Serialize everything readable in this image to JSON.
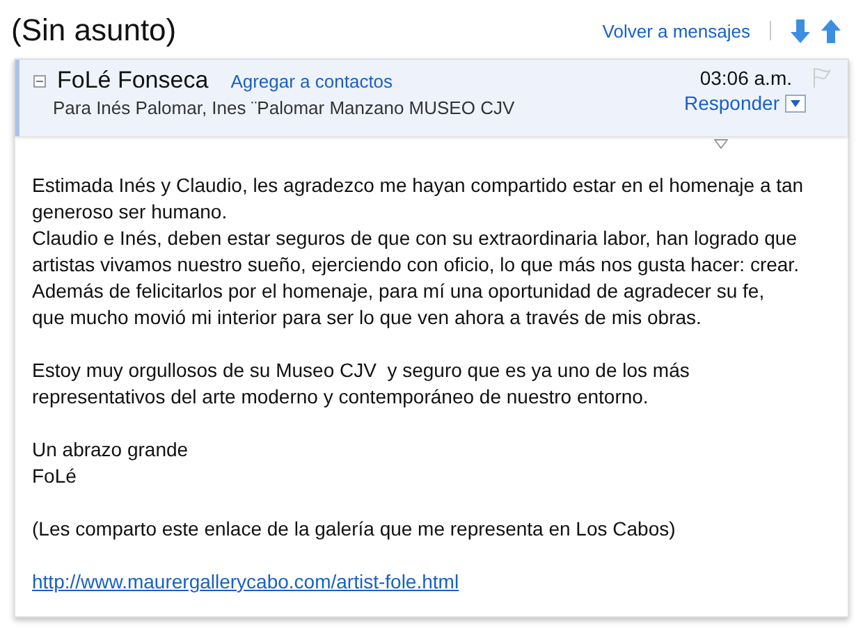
{
  "subject": "(Sin asunto)",
  "back_link": "Volver a mensajes",
  "message": {
    "sender": "FoLé Fonseca",
    "add_contact": "Agregar a contactos",
    "recipients": "Para Inés Palomar, Ines ¨Palomar Manzano MUSEO CJV",
    "time": "03:06 a.m.",
    "reply": "Responder",
    "flagged": false,
    "expanded": true
  },
  "body": [
    {
      "kind": "text",
      "text": "Estimada Inés y Claudio, les agradezco me hayan compartido estar en el homenaje a tan\ngeneroso ser humano.\nClaudio e Inés, deben estar seguros de que con su extraordinaria labor, han logrado que\nartistas vivamos nuestro sueño, ejerciendo con oficio, lo que más nos gusta hacer: crear.\nAdemás de felicitarlos por el homenaje, para mí una oportunidad de agradecer su fe,\nque mucho movió mi interior para ser lo que ven ahora a través de mis obras."
    },
    {
      "kind": "text",
      "text": "Estoy muy orgullosos de su Museo CJV  y seguro que es ya uno de los más\nrepresentativos del arte moderno y contemporáneo de nuestro entorno."
    },
    {
      "kind": "text",
      "text": "Un abrazo grande\nFoLé"
    },
    {
      "kind": "text",
      "text": "(Les comparto este enlace de la galería que me representa en Los Cabos)"
    },
    {
      "kind": "link",
      "text": "http://www.maurergallerycabo.com/artist-fole.html"
    }
  ]
}
